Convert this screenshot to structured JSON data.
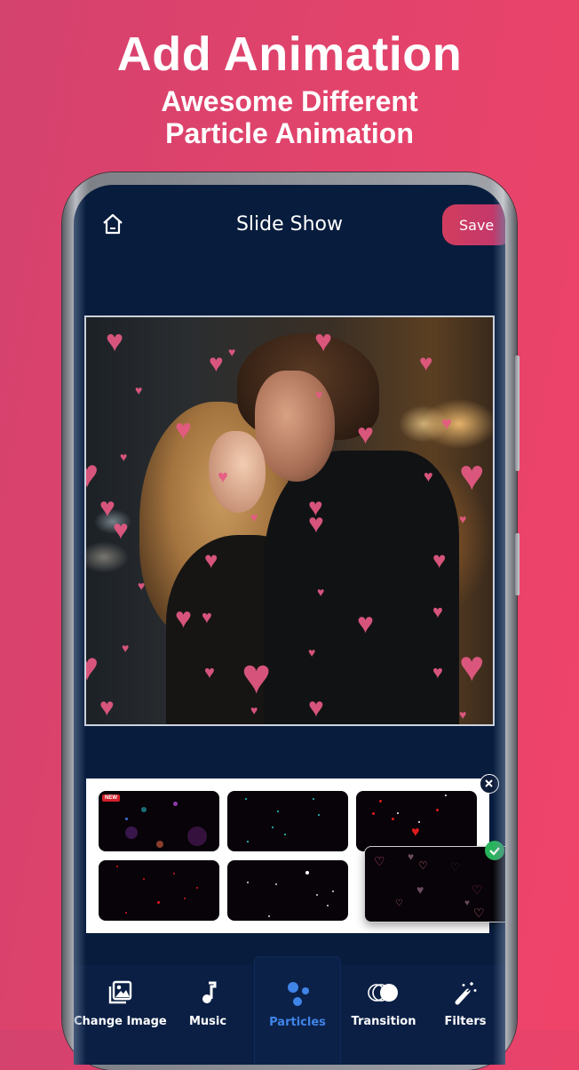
{
  "promo": {
    "title": "Add Animation",
    "subtitle_line1": "Awesome Different",
    "subtitle_line2": "Particle Animation"
  },
  "app": {
    "title": "Slide Show",
    "home_icon": "home-icon",
    "save_label": "Save",
    "accent_color": "#3f84e8",
    "save_color": "#d23d5e",
    "background_color": "#081c3d"
  },
  "preview": {
    "description": "couple kissing in rain at night with pink heart particles",
    "particle_icon": "heart-icon",
    "particle_color": "#e75a84"
  },
  "particle_panel": {
    "close_icon": "close-icon",
    "check_icon": "check-icon",
    "selected_index": 5,
    "items": [
      {
        "name": "bokeh-purple",
        "badge": "NEW"
      },
      {
        "name": "cyan-dots",
        "badge": ""
      },
      {
        "name": "red-white-hearts",
        "badge": ""
      },
      {
        "name": "red-dots",
        "badge": ""
      },
      {
        "name": "white-dots",
        "badge": ""
      },
      {
        "name": "outline-hearts",
        "badge": ""
      }
    ]
  },
  "bottom_nav": {
    "active": "Particles",
    "items": [
      {
        "label": "Change Image",
        "icon": "image-gallery-icon"
      },
      {
        "label": "Music",
        "icon": "music-note-icon"
      },
      {
        "label": "Particles",
        "icon": "particles-icon"
      },
      {
        "label": "Transition",
        "icon": "transition-icon"
      },
      {
        "label": "Filters",
        "icon": "magic-wand-icon"
      }
    ]
  }
}
